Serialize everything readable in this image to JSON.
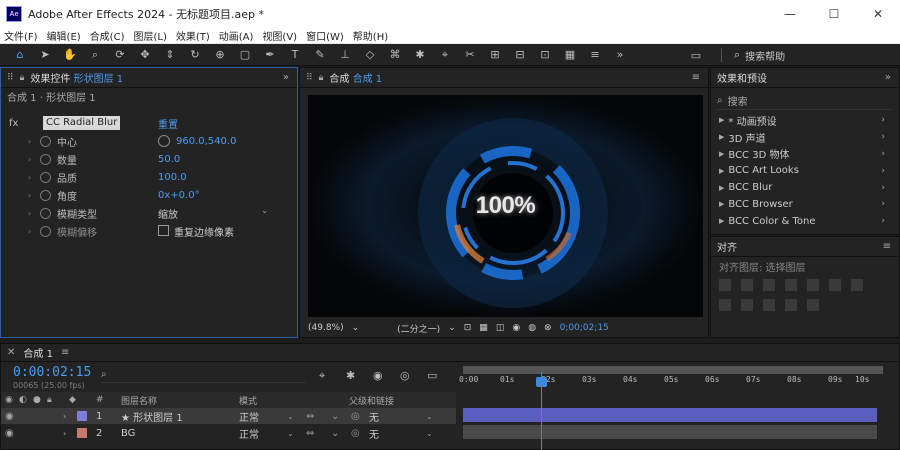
{
  "window": {
    "app_badge": "Ae",
    "title": "Adobe After Effects 2024 - 无标题项目.aep *",
    "controls": [
      "—",
      "☐",
      "✕"
    ]
  },
  "menu": [
    "文件(F)",
    "编辑(E)",
    "合成(C)",
    "图层(L)",
    "效果(T)",
    "动画(A)",
    "视图(V)",
    "窗口(W)",
    "帮助(H)"
  ],
  "toolbar": {
    "help_search": "搜索帮助"
  },
  "effect_controls": {
    "tab_prefix": "效果控件",
    "tab_layer": "形状图层 1",
    "tab_menu": "≡",
    "subheader": "合成 1 · 形状图层 1",
    "fx_label": "fx",
    "effect_name": "CC Radial Blur",
    "reset": "重置",
    "rows": [
      {
        "label": "中心",
        "value": "960.0,540.0"
      },
      {
        "label": "数量",
        "value": "50.0"
      },
      {
        "label": "品质",
        "value": "100.0"
      },
      {
        "label": "角度",
        "value": "0x+0.0°"
      },
      {
        "label": "模糊类型",
        "value": "缩放"
      },
      {
        "label": "模糊偏移",
        "value": "重复边缘像素"
      }
    ]
  },
  "composition": {
    "tab_prefix": "合成",
    "tab_name": "合成 1",
    "percent_text": "100%",
    "zoom": "(49.8%)",
    "resolution": "(二分之一)",
    "frame_info": "0;00;02;15"
  },
  "effects_presets": {
    "title": "效果和预设",
    "search_placeholder": "搜索",
    "items": [
      "* 动画预设",
      "3D 声道",
      "BCC 3D 物体",
      "BCC Art Looks",
      "BCC Blur",
      "BCC Browser",
      "BCC Color & Tone"
    ]
  },
  "align": {
    "title": "对齐",
    "align_to": "对齐图层: 选择图层"
  },
  "timeline": {
    "tab": "合成 1",
    "timecode": "0:00:02:15",
    "timecode_sub": "00065 (25.00 fps)",
    "search_placeholder": "",
    "columns": {
      "layer_name": "图层名称",
      "mode": "模式",
      "parent": "父级和链接"
    },
    "layers": [
      {
        "num": "1",
        "name": "★ 形状图层 1",
        "mode": "正常",
        "parent": "无",
        "color": "#7b7fd9"
      },
      {
        "num": "2",
        "name": "BG",
        "mode": "正常",
        "parent": "无",
        "color": "#c87a6e"
      }
    ],
    "ruler_labels": [
      "0:00",
      "01s",
      "02s",
      "03s",
      "04s",
      "05s",
      "06s",
      "07s",
      "08s",
      "09s",
      "10s"
    ]
  }
}
